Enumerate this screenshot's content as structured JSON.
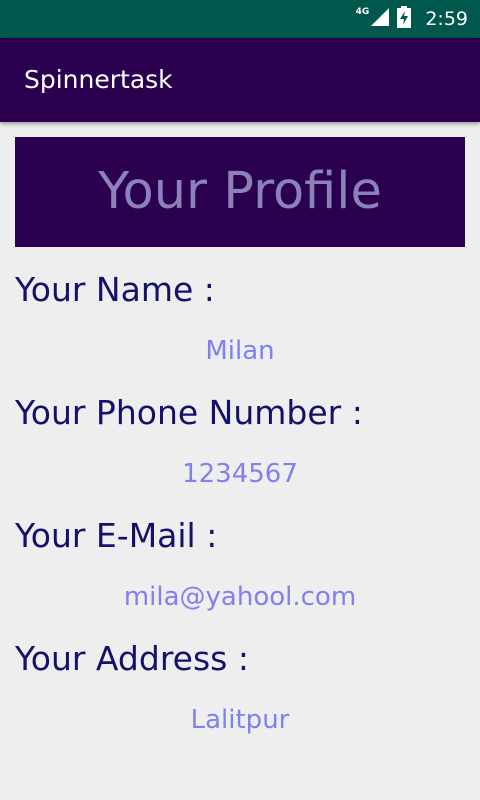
{
  "status_bar": {
    "network": "4G",
    "time": "2:59",
    "icons": [
      "signal-icon",
      "battery-charging-icon"
    ]
  },
  "app_bar": {
    "title": "Spinnertask"
  },
  "profile": {
    "header": "Your Profile",
    "fields": [
      {
        "label": "Your Name :",
        "value": "Milan"
      },
      {
        "label": "Your Phone Number :",
        "value": "1234567"
      },
      {
        "label": "Your E-Mail :",
        "value": "mila@yahool.com"
      },
      {
        "label": "Your Address :",
        "value": "Lalitpur"
      }
    ]
  },
  "colors": {
    "status_bar": "#00574b",
    "app_bar": "#2a004f",
    "label_text": "#14116b",
    "value_text": "#8080f0",
    "header_text": "#8a82b8",
    "background": "#eeeeee"
  }
}
